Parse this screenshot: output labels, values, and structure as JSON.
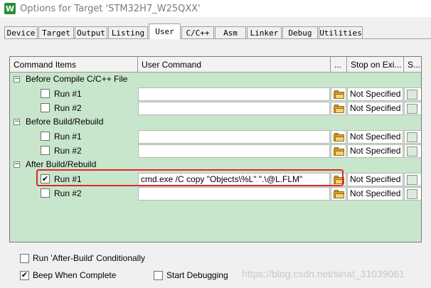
{
  "window": {
    "title": "Options for Target 'STM32H7_W25QXX'",
    "icon_letter": "W"
  },
  "tabs": [
    "Device",
    "Target",
    "Output",
    "Listing",
    "User",
    "C/C++",
    "Asm",
    "Linker",
    "Debug",
    "Utilities"
  ],
  "active_tab": "User",
  "grid": {
    "headers": [
      "Command Items",
      "User Command",
      "...",
      "Stop on Exi...",
      "S..."
    ],
    "groups": [
      {
        "label": "Before Compile C/C++ File",
        "items": [
          {
            "label": "Run #1",
            "checked": false,
            "command": "",
            "stop": "Not Specified"
          },
          {
            "label": "Run #2",
            "checked": false,
            "command": "",
            "stop": "Not Specified"
          }
        ]
      },
      {
        "label": "Before Build/Rebuild",
        "items": [
          {
            "label": "Run #1",
            "checked": false,
            "command": "",
            "stop": "Not Specified"
          },
          {
            "label": "Run #2",
            "checked": false,
            "command": "",
            "stop": "Not Specified"
          }
        ]
      },
      {
        "label": "After Build/Rebuild",
        "items": [
          {
            "label": "Run #1",
            "checked": true,
            "command": "cmd.exe /C copy \"Objects\\%L\" \".\\@L.FLM\"",
            "stop": "Not Specified"
          },
          {
            "label": "Run #2",
            "checked": false,
            "command": "",
            "stop": "Not Specified"
          }
        ]
      }
    ],
    "collapse_symbol": "⊟",
    "check_mark": "✔"
  },
  "options": {
    "run_after_build": {
      "label": "Run 'After-Build' Conditionally",
      "checked": false
    },
    "beep": {
      "label": "Beep When Complete",
      "checked": true
    },
    "start_debugging": {
      "label": "Start Debugging",
      "checked": false
    }
  },
  "watermark": "https://blog.csdn.net/sinat_31039061",
  "colors": {
    "grid_bg": "#c8e6cb",
    "highlight": "#e0262a"
  }
}
